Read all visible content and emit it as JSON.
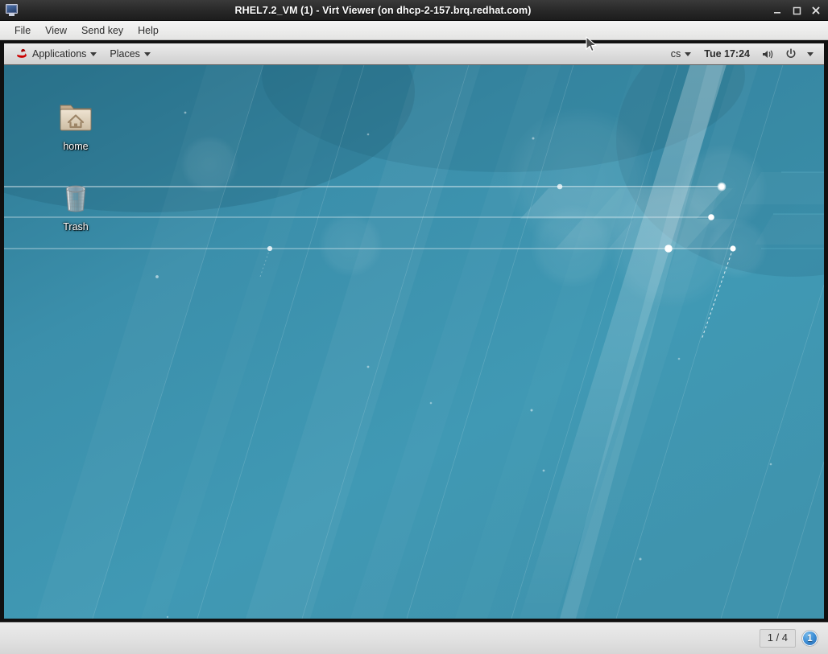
{
  "window": {
    "icon": "monitor-icon",
    "title": "RHEL7.2_VM (1) - Virt Viewer (on dhcp-2-157.brq.redhat.com)",
    "controls": [
      {
        "name": "minimize",
        "label": "–"
      },
      {
        "name": "maximize",
        "label": "□"
      },
      {
        "name": "close",
        "label": "✕"
      }
    ]
  },
  "menubar": {
    "items": [
      {
        "name": "file",
        "label": "File"
      },
      {
        "name": "view",
        "label": "View"
      },
      {
        "name": "send-key",
        "label": "Send key"
      },
      {
        "name": "help",
        "label": "Help"
      }
    ]
  },
  "gnome_panel": {
    "logo": "redhat-logo-icon",
    "applications": "Applications",
    "places": "Places",
    "keyboard_layout": "cs",
    "clock": "Tue 17:24",
    "volume_icon": "speaker-icon",
    "power_icon": "power-icon",
    "system_menu_caret": "chevron-down-icon"
  },
  "desktop": {
    "icons": [
      {
        "name": "home-folder",
        "label": "home",
        "glyph": "folder-home-icon"
      },
      {
        "name": "trash",
        "label": "Trash",
        "glyph": "trash-can-icon"
      }
    ],
    "wallpaper": {
      "name": "rhel7-default-wallpaper",
      "base_color": "#3d94b0",
      "dark_color": "#2b768f",
      "light_color": "#6fc0d4"
    }
  },
  "statusbar": {
    "page_indicator": "1 / 4",
    "display_badge": "1"
  }
}
